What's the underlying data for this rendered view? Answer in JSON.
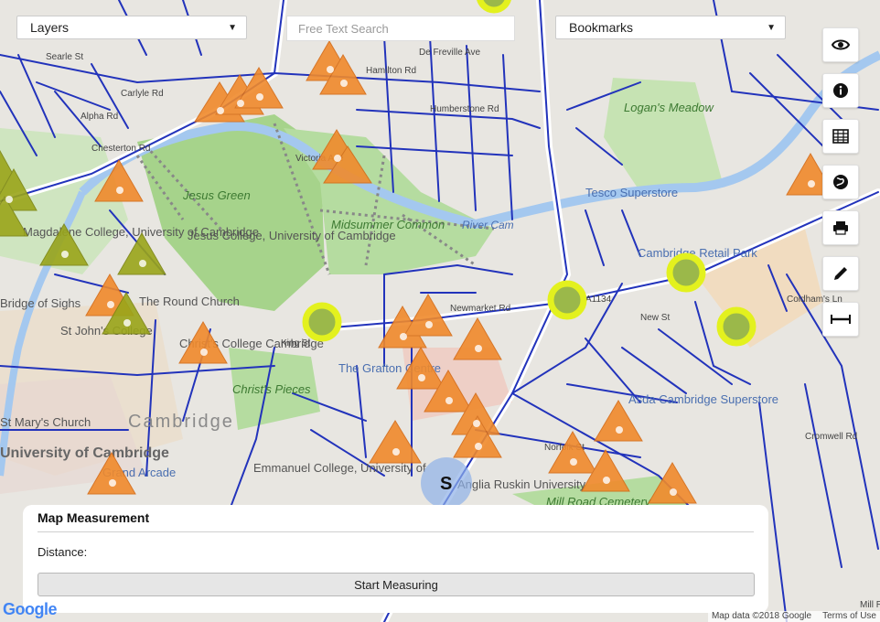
{
  "controls": {
    "layers_label": "Layers",
    "search_placeholder": "Free Text Search",
    "bookmarks_label": "Bookmarks"
  },
  "toolbar": {
    "items": [
      {
        "name": "eye-icon"
      },
      {
        "name": "info-icon"
      },
      {
        "name": "table-icon"
      },
      {
        "name": "globe-icon"
      },
      {
        "name": "print-icon"
      },
      {
        "name": "pencil-icon"
      },
      {
        "name": "measure-icon"
      }
    ]
  },
  "measurement": {
    "title": "Map Measurement",
    "distance_label": "Distance:",
    "start_button": "Start Measuring"
  },
  "map": {
    "place_labels": [
      "Jesus Green",
      "Midsummer Common",
      "Logan's Meadow",
      "Jesus College, University of Cambridge",
      "Magdalene College, University of Cambridge",
      "The Round Church",
      "St John's College",
      "Christ's College Cambridge",
      "Christ's Pieces",
      "The Grafton Centre",
      "Tesco Superstore",
      "Cambridge Retail Park",
      "Asda Cambridge Superstore",
      "Emmanuel College, University of",
      "Anglia Ruskin University",
      "St Mary's Church",
      "University of Cambridge",
      "Grand Arcade",
      "Mill Road Cemetery",
      "Cambridge",
      "Bridge of Sighs",
      "River Cam"
    ],
    "street_labels": [
      "Searle St",
      "Carlyle Rd",
      "Alpha Rd",
      "Chesterton Rd",
      "Hamilton Rd",
      "Humberstone Rd",
      "Newmarket Rd",
      "New St",
      "A1134",
      "Coldham's Ln",
      "Cromwell Rd",
      "Mill Rd",
      "Norfolk St",
      "King St",
      "Victoria Ave",
      "De Freville Ave"
    ],
    "city_label": "Cambridge",
    "google_logo": "Google",
    "attribution": "Map data ©2018 Google",
    "terms": "Terms of Use",
    "marker_letter": "S",
    "colors": {
      "road": "#2233bb",
      "orange_marker": "#f08a2c",
      "olive_marker": "#9aa51a",
      "yellow_circle": "#e3f11e",
      "park": "#a6d38b",
      "river": "#a4c8ef"
    }
  }
}
